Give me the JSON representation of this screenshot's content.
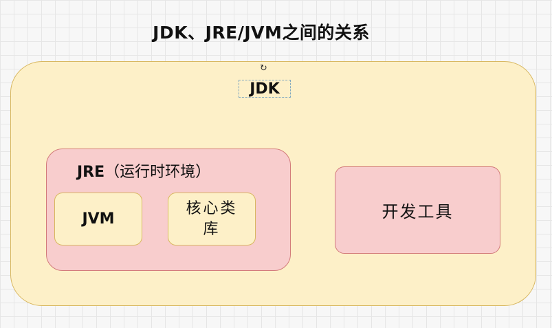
{
  "title": "JDK、JRE/JVM之间的关系",
  "jdk": {
    "label": "JDK",
    "selection_handle": "rotate-handle-icon"
  },
  "jre": {
    "label_name": "JRE",
    "label_desc": "（运行时环境）"
  },
  "jvm": {
    "label": "JVM"
  },
  "core_lib": {
    "label": "核心类库"
  },
  "dev_tools": {
    "label": "开发工具"
  },
  "colors": {
    "jdk_fill": "#fdf0c8",
    "jdk_border": "#d8b75f",
    "jre_fill": "#f8cdcd",
    "jre_border": "#d27a7a"
  }
}
